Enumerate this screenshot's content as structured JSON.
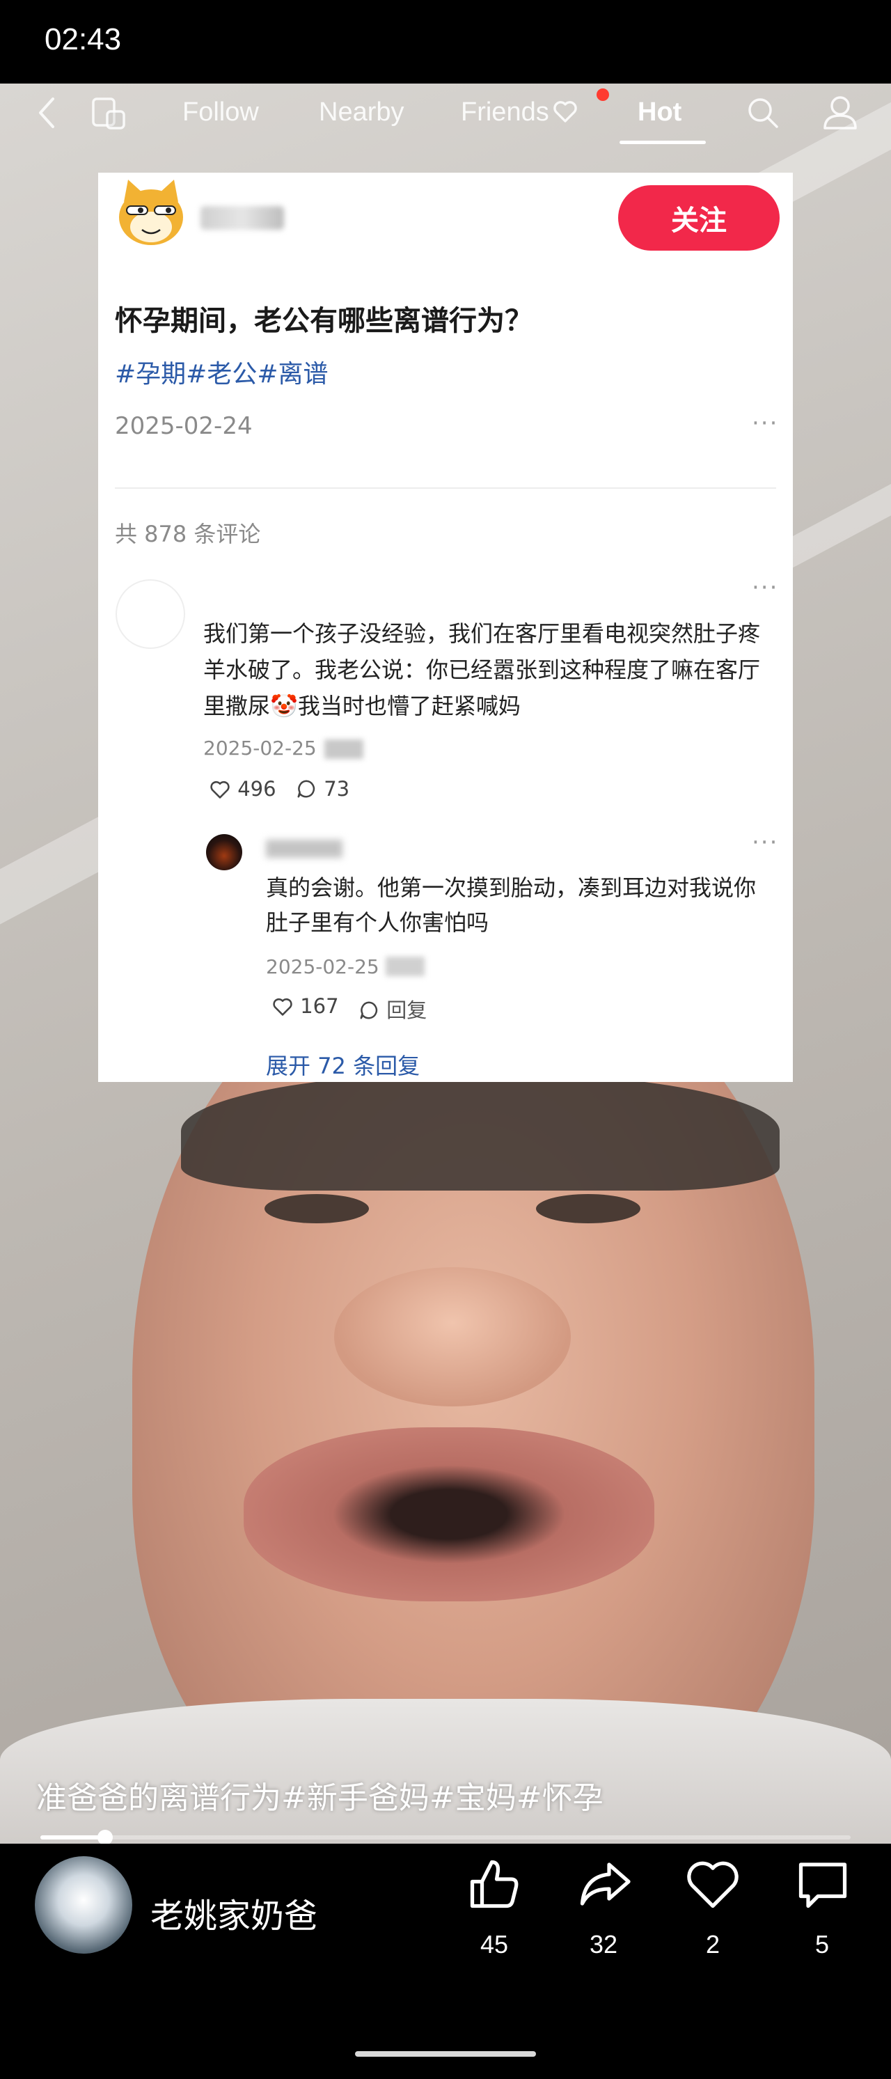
{
  "status_bar": {
    "time": "02:43"
  },
  "nav": {
    "follow": "Follow",
    "nearby": "Nearby",
    "friends": "Friends",
    "hot": "Hot",
    "icons": [
      "back-icon",
      "multi-window-icon",
      "heart-outline-icon",
      "search-icon",
      "profile-icon"
    ]
  },
  "card": {
    "follow_button": "关注",
    "title": "怀孕期间，老公有哪些离谱行为？",
    "tags": "#孕期#老公#离谱",
    "date": "2025-02-24",
    "more": "···",
    "comment_count": "共 878 条评论",
    "comment1": {
      "text": "我们第一个孩子没经验，我们在客厅里看电视突然肚子疼羊水破了。我老公说：你已经嚣张到这种程度了嘛在客厅里撒尿🤡我当时也懵了赶紧喊妈",
      "date": "2025-02-25",
      "likes": "496",
      "replies": "73"
    },
    "comment2": {
      "text": "真的会谢。他第一次摸到胎动，凑到耳边对我说你肚子里有个人你害怕吗",
      "date": "2025-02-25",
      "likes": "167",
      "reply_label": "回复"
    },
    "expand": "展开 72 条回复"
  },
  "caption": "准爸爸的离谱行为#新手爸妈#宝妈#怀孕",
  "progress": 0.08,
  "author": {
    "name": "老姚家奶爸"
  },
  "actions": {
    "like": "45",
    "share": "32",
    "favorite": "2",
    "comment": "5"
  }
}
